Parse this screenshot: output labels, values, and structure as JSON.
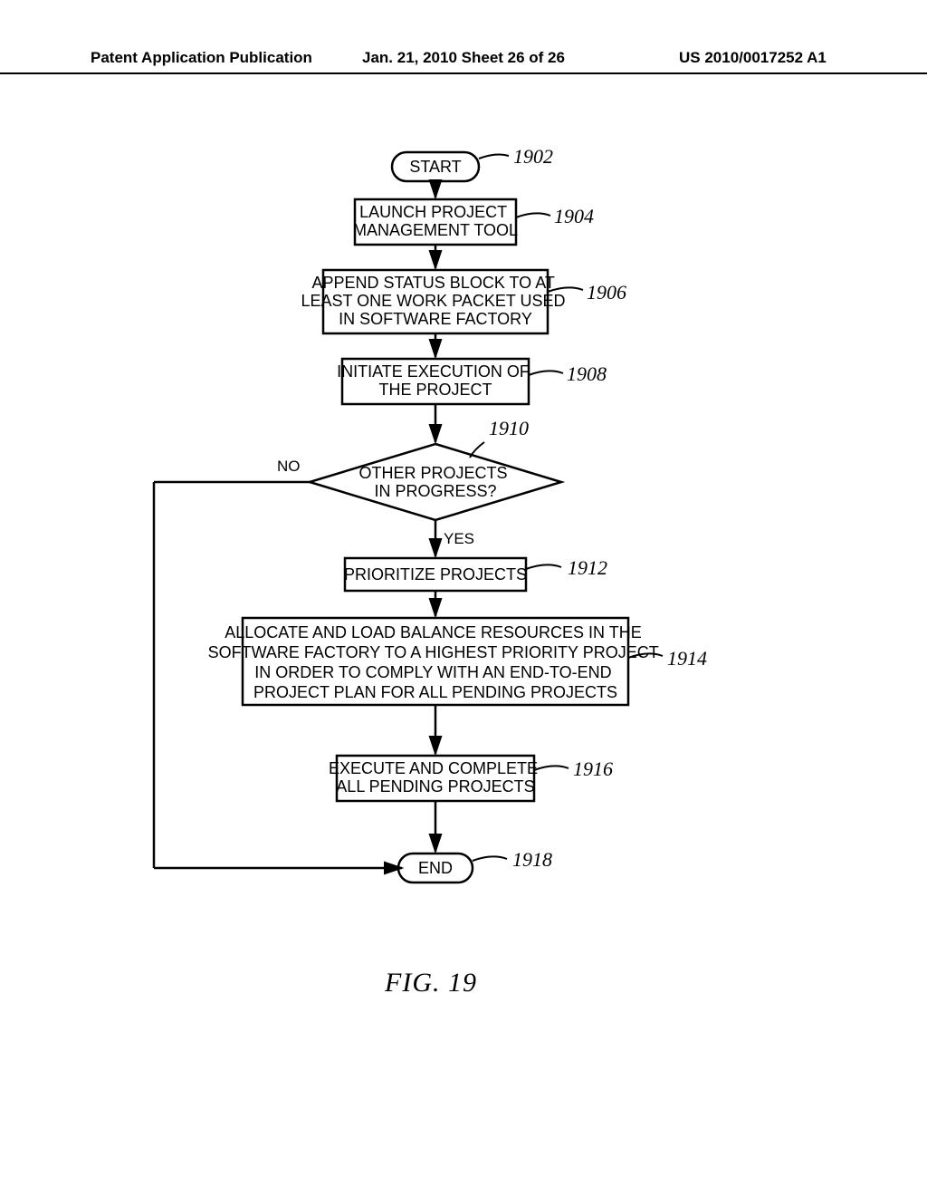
{
  "header": {
    "left": "Patent Application Publication",
    "mid": "Jan. 21, 2010  Sheet 26 of 26",
    "right": "US 2010/0017252 A1"
  },
  "figure_caption": "FIG. 19",
  "nodes": {
    "start": "START",
    "launch": "LAUNCH PROJECT\nMANAGEMENT TOOL",
    "append": "APPEND STATUS BLOCK TO AT\nLEAST ONE WORK PACKET USED\nIN SOFTWARE FACTORY",
    "initiate": "INITIATE EXECUTION OF\nTHE PROJECT",
    "decision": "OTHER PROJECTS\nIN PROGRESS?",
    "prioritize": "PRIORITIZE PROJECTS",
    "allocate": "ALLOCATE AND LOAD BALANCE RESOURCES IN THE\nSOFTWARE FACTORY TO A HIGHEST PRIORITY PROJECT\nIN ORDER TO COMPLY WITH AN END-TO-END\nPROJECT PLAN FOR ALL PENDING PROJECTS",
    "execute": "EXECUTE AND COMPLETE\nALL PENDING PROJECTS",
    "end": "END"
  },
  "labels": {
    "n1902": "1902",
    "n1904": "1904",
    "n1906": "1906",
    "n1908": "1908",
    "n1910": "1910",
    "n1912": "1912",
    "n1914": "1914",
    "n1916": "1916",
    "n1918": "1918"
  },
  "branches": {
    "no": "NO",
    "yes": "YES"
  }
}
